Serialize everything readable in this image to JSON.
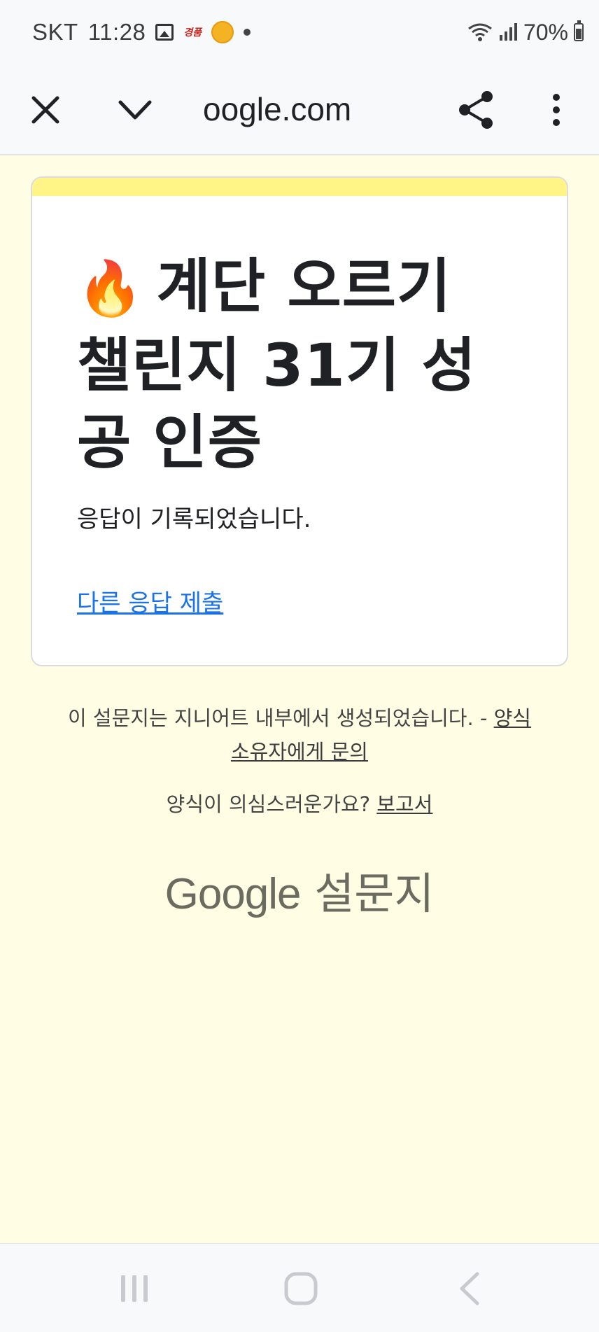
{
  "status_bar": {
    "carrier": "SKT",
    "time": "11:28",
    "notif_text": "경품",
    "battery": "70%"
  },
  "toolbar": {
    "url": "oogle.com"
  },
  "card": {
    "title_emoji": "🔥",
    "title": "계단 오르기 챌린지 31기 성공 인증",
    "message": "응답이 기록되었습니다.",
    "another_response_link": "다른 응답 제출"
  },
  "footer": {
    "created_text": "이 설문지는 지니어트 내부에서 생성되었습니다. -",
    "contact_owner_link": "양식 소유자에게 문의",
    "suspicious_text": "양식이 의심스러운가요?",
    "report_link": "보고서",
    "brand_google": "Google",
    "brand_forms": "설문지"
  },
  "colors": {
    "background": "#fffee4",
    "card_accent": "#fff485",
    "link": "#1a73e8"
  },
  "icons": [
    "close-icon",
    "chevron-down-icon",
    "share-icon",
    "more-vert-icon",
    "recents-icon",
    "home-icon",
    "back-icon"
  ]
}
